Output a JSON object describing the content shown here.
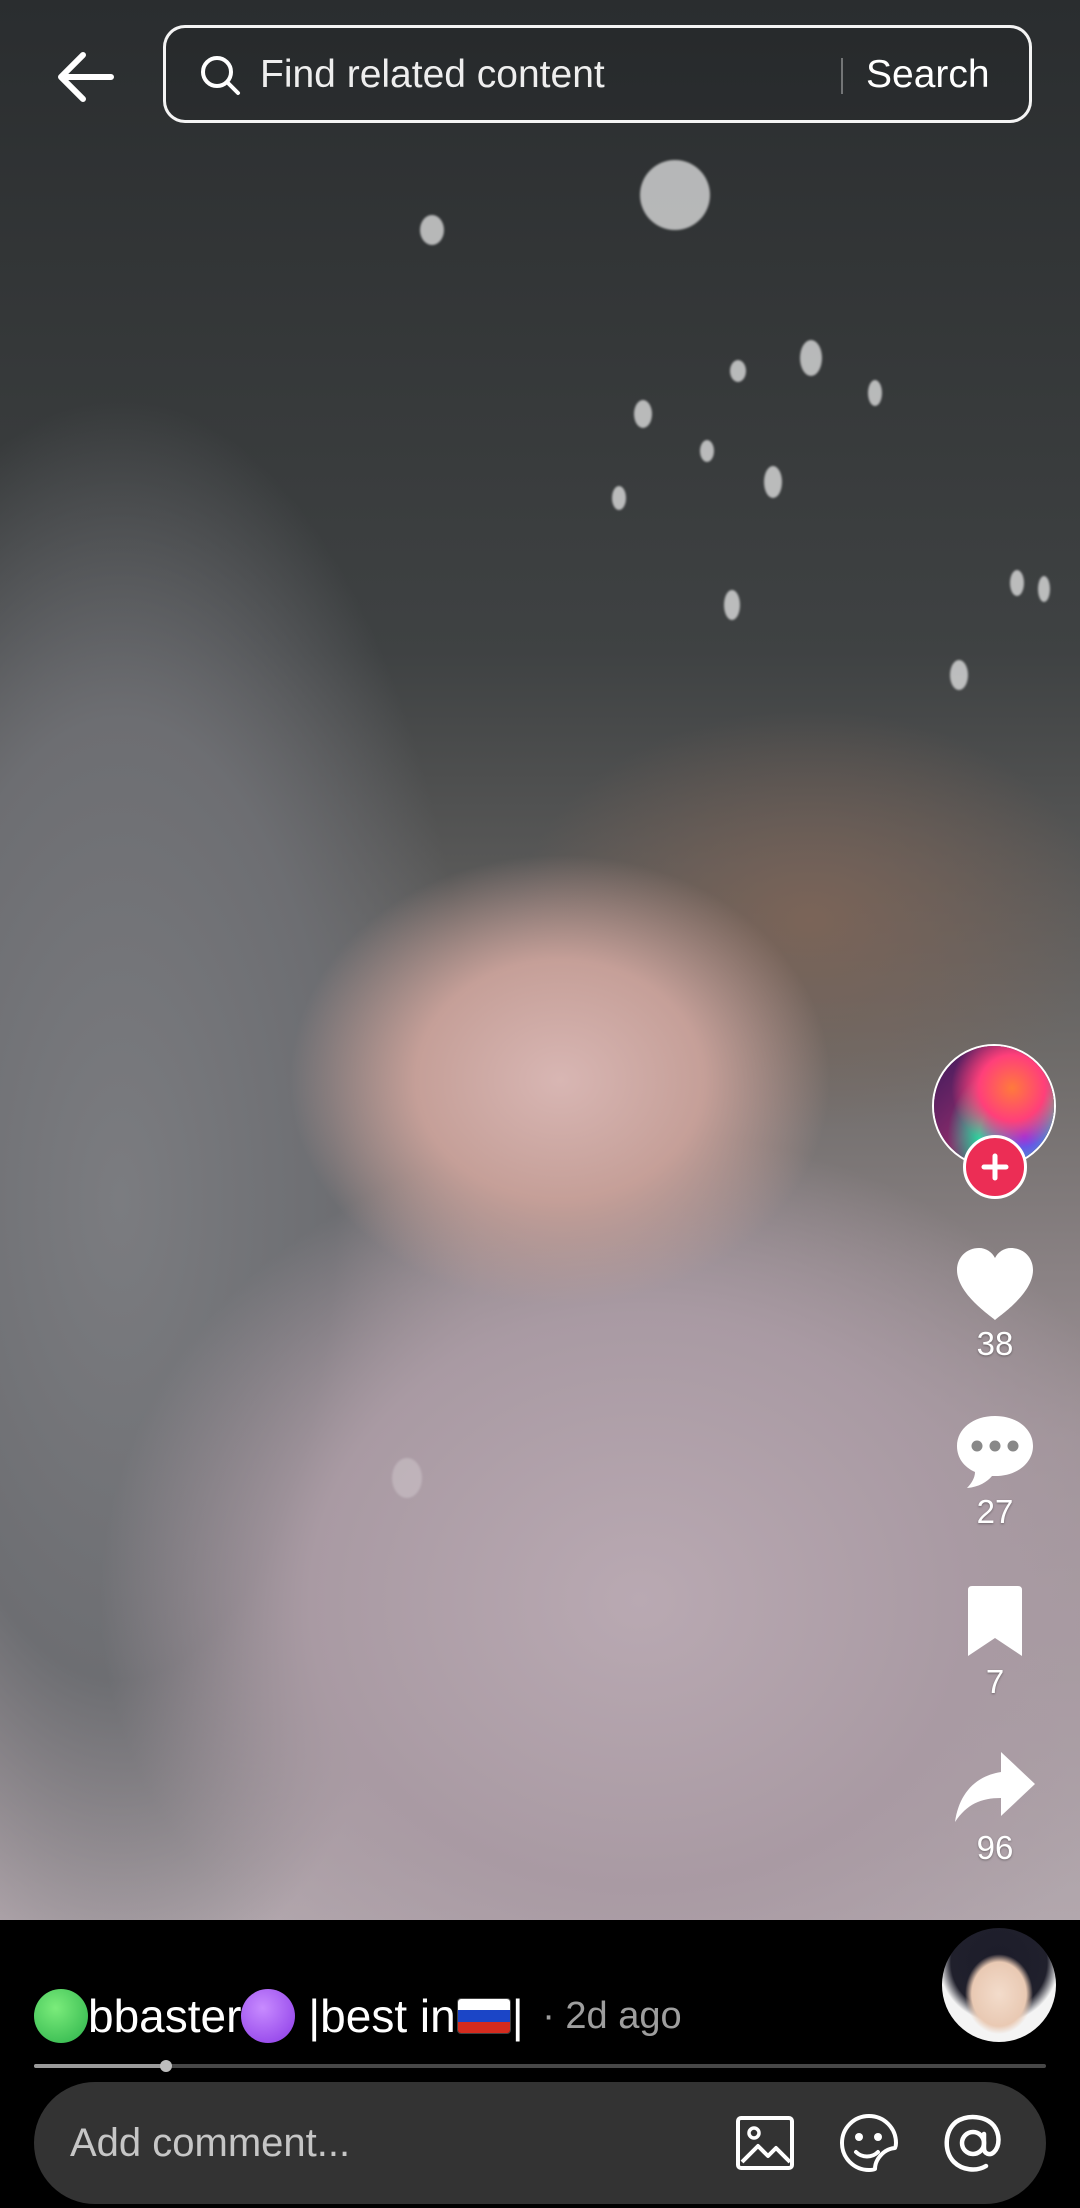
{
  "top_bar": {
    "back_icon": "arrow-left-icon",
    "search_placeholder": "Find related content",
    "search_button": "Search"
  },
  "video": {
    "description": "Full-screen vertical video"
  },
  "actions": {
    "creator_avatar_icon": "creator-avatar",
    "follow_icon": "plus-icon",
    "like": {
      "icon": "heart-icon",
      "count": "38"
    },
    "comment": {
      "icon": "comment-bubble-icon",
      "count": "27"
    },
    "favorite": {
      "icon": "bookmark-icon",
      "count": "7"
    },
    "share": {
      "icon": "share-arrow-icon",
      "count": "96"
    }
  },
  "caption": {
    "name": "bbaster",
    "tagline": " |best in",
    "tail": "|",
    "time": " · 2d ago"
  },
  "progress": {
    "fraction": 0.13
  },
  "comment_bar": {
    "placeholder": "Add comment...",
    "image_icon": "image-icon",
    "sticker_icon": "sticker-icon",
    "mention_icon": "at-mention-icon"
  },
  "colors": {
    "follow_red": "#ec2d55",
    "comment_bar_bg": "#333333"
  }
}
